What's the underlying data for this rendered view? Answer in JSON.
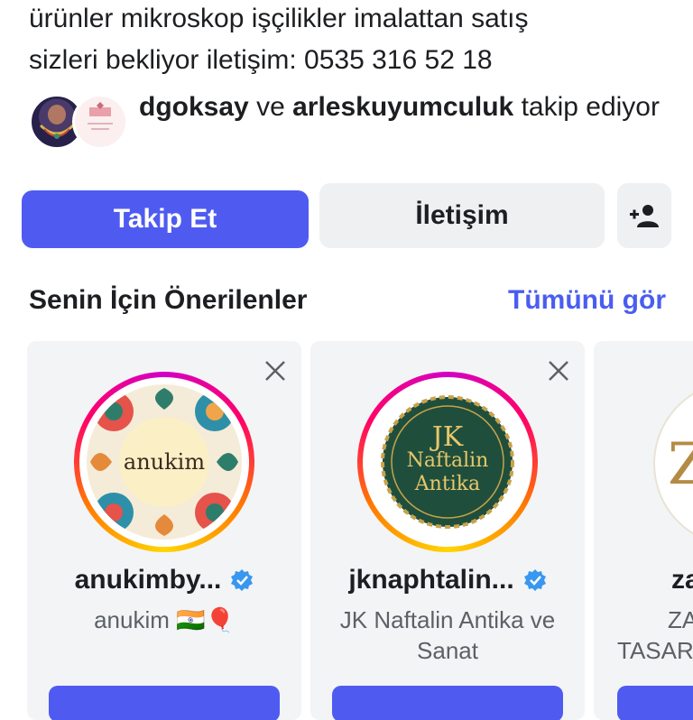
{
  "profile": {
    "bio_line1": "ürünler mikroskop işçilikler imalattan satış",
    "bio_line2": "sizleri bekliyor iletişim: 0535 316 52 18",
    "followed_by": {
      "user1": "dgoksay",
      "connector": "ve",
      "user2": "arleskuyumculuk",
      "suffix": "takip ediyor"
    }
  },
  "actions": {
    "follow_label": "Takip Et",
    "contact_label": "İletişim",
    "add_person_icon": "person-add-icon"
  },
  "suggestions": {
    "title": "Senin İçin Önerilenler",
    "see_all": "Tümünü gör",
    "cards": [
      {
        "username": "anukimby...",
        "full_name": "anukim 🇮🇳🎈",
        "logo_text": "anukim",
        "verified": true
      },
      {
        "username": "jknaphtalin...",
        "full_name": "JK Naftalin Antika ve Sanat",
        "logo_lines": [
          "JK",
          "Naftalin",
          "Antika"
        ],
        "verified": true
      },
      {
        "username": "za",
        "full_name_line1": "ZA",
        "full_name_line2": "TASAR",
        "logo_letter": "Z"
      }
    ]
  },
  "colors": {
    "primary": "#4f5bf0",
    "link": "#4a5df0",
    "verified": "#3897f0",
    "secondary_button": "#eff0f2"
  }
}
